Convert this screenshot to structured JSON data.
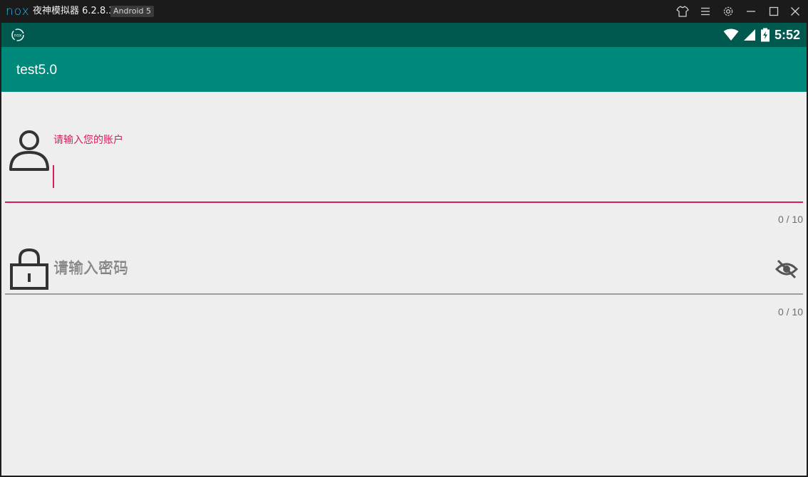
{
  "emulator": {
    "logo_text": "nox",
    "title": "夜神模拟器 6.2.8.3",
    "android_badge": "Android 5",
    "buttons": [
      "skin-icon",
      "menu-icon",
      "settings-icon",
      "minimize-icon",
      "maximize-icon",
      "close-icon"
    ]
  },
  "status_bar": {
    "time": "5:52",
    "icons": [
      "nox-assistant-icon",
      "wifi-icon",
      "cell-signal-icon",
      "battery-charging-icon"
    ],
    "color": "#00594f"
  },
  "app_bar": {
    "title": "test5.0",
    "color": "#00897b"
  },
  "form": {
    "account": {
      "floating_label": "请输入您的账户",
      "value": "",
      "counter": "0 / 10",
      "icon": "person-icon",
      "focused": true
    },
    "password": {
      "placeholder": "请输入密码",
      "value": "",
      "counter": "0 / 10",
      "icon": "lock-icon",
      "toggle_icon": "visibility-off-icon",
      "focused": false
    },
    "accent_color": "#d81b60"
  }
}
